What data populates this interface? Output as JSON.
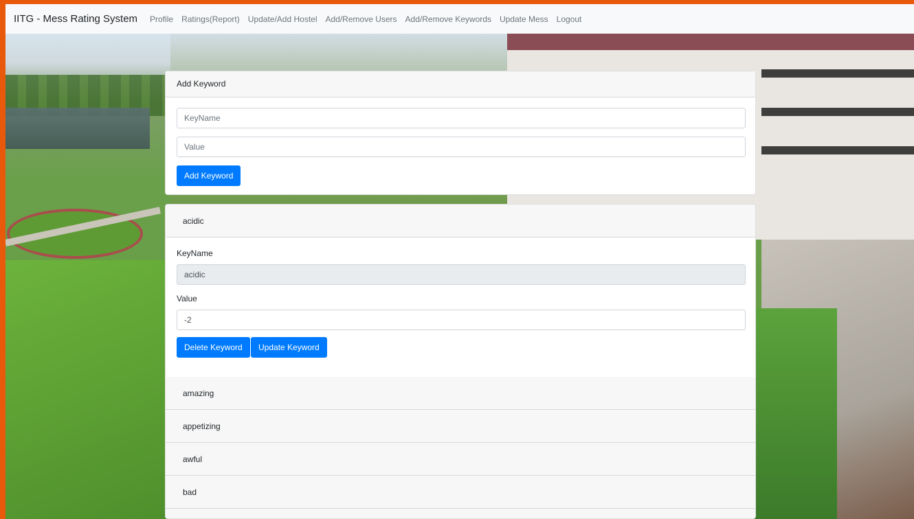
{
  "nav": {
    "brand": "IITG - Mess Rating System",
    "links": [
      "Profile",
      "Ratings(Report)",
      "Update/Add Hostel",
      "Add/Remove Users",
      "Add/Remove Keywords",
      "Update Mess",
      "Logout"
    ]
  },
  "add_keyword": {
    "header": "Add Keyword",
    "keyname_placeholder": "KeyName",
    "value_placeholder": "Value",
    "button_label": "Add Keyword"
  },
  "keywords": {
    "expanded": {
      "title": "acidic",
      "keyname_label": "KeyName",
      "keyname_value": "acidic",
      "value_label": "Value",
      "value_value": "-2",
      "delete_label": "Delete Keyword",
      "update_label": "Update Keyword"
    },
    "collapsed": [
      "amazing",
      "appetizing",
      "awful",
      "bad"
    ]
  },
  "colors": {
    "primary": "#007bff",
    "navbar_bg": "#f8f9fa",
    "frame_border": "#e8590c"
  }
}
